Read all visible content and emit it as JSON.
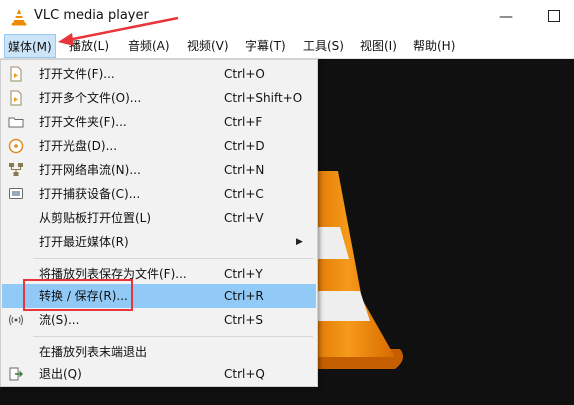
{
  "window": {
    "title": "VLC media player",
    "minimize_glyph": "—",
    "maximize_glyph": ""
  },
  "menubar": [
    "媒体(M)",
    "播放(L)",
    "音频(A)",
    "视频(V)",
    "字幕(T)",
    "工具(S)",
    "视图(I)",
    "帮助(H)"
  ],
  "media_menu": {
    "items": [
      {
        "label": "打开文件(F)...",
        "shortcut": "Ctrl+O",
        "icon": "file-icon"
      },
      {
        "label": "打开多个文件(O)...",
        "shortcut": "Ctrl+Shift+O",
        "icon": "files-icon"
      },
      {
        "label": "打开文件夹(F)...",
        "shortcut": "Ctrl+F",
        "icon": "folder-icon"
      },
      {
        "label": "打开光盘(D)...",
        "shortcut": "Ctrl+D",
        "icon": "disc-icon"
      },
      {
        "label": "打开网络串流(N)...",
        "shortcut": "Ctrl+N",
        "icon": "network-icon"
      },
      {
        "label": "打开捕获设备(C)...",
        "shortcut": "Ctrl+C",
        "icon": "capture-device-icon"
      },
      {
        "label": "从剪贴板打开位置(L)",
        "shortcut": "Ctrl+V",
        "icon": ""
      },
      {
        "label": "打开最近媒体(R)",
        "shortcut": "",
        "icon": "",
        "submenu": true
      },
      {
        "label": "将播放列表保存为文件(F)...",
        "shortcut": "Ctrl+Y",
        "icon": ""
      },
      {
        "label": "转换 / 保存(R)...",
        "shortcut": "Ctrl+R",
        "icon": "",
        "highlighted": true
      },
      {
        "label": "流(S)...",
        "shortcut": "Ctrl+S",
        "icon": "stream-icon"
      },
      {
        "label": "在播放列表末端退出",
        "shortcut": "",
        "icon": ""
      },
      {
        "label": "退出(Q)",
        "shortcut": "Ctrl+Q",
        "icon": "exit-icon"
      }
    ],
    "submenu_arrow": "▶"
  },
  "colors": {
    "highlight": "#91c9f7",
    "menu_active": "#cce4f7",
    "annotation_red": "#e8353b",
    "cone_orange": "#f08a00"
  }
}
